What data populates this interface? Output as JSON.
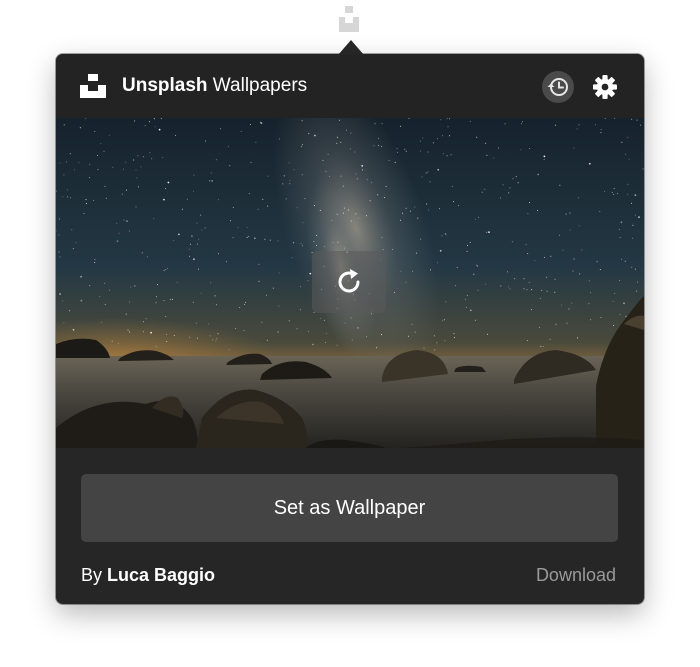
{
  "header": {
    "brand_bold": "Unsplash",
    "brand_rest": " Wallpapers",
    "history_icon": "history-clock-icon",
    "settings_icon": "gear-icon"
  },
  "photo": {
    "refresh_icon": "refresh-icon"
  },
  "actions": {
    "set_wallpaper_label": "Set as Wallpaper",
    "download_label": "Download"
  },
  "credit": {
    "prefix": "By ",
    "author": "Luca Baggio"
  },
  "colors": {
    "popover_bg": "#262626",
    "button_bg": "#444444",
    "muted_text": "#9a9a9a"
  }
}
